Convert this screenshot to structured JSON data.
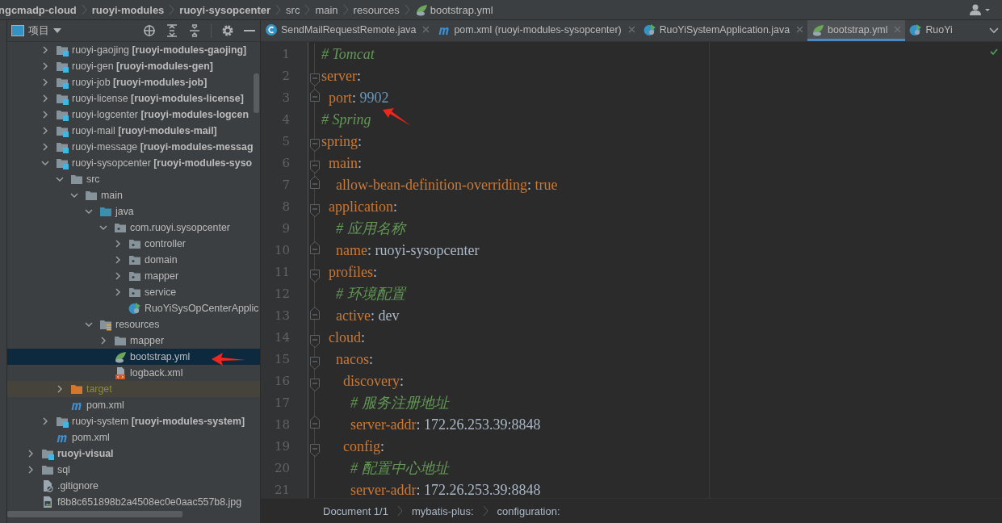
{
  "breadcrumbs": [
    {
      "label": "ngcmadp-cloud",
      "kind": "module"
    },
    {
      "label": "ruoyi-modules",
      "kind": "module"
    },
    {
      "label": "ruoyi-sysopcenter",
      "kind": "module"
    },
    {
      "label": "src",
      "kind": "folder"
    },
    {
      "label": "main",
      "kind": "folder"
    },
    {
      "label": "resources",
      "kind": "folder"
    },
    {
      "label": "bootstrap.yml",
      "kind": "yml"
    }
  ],
  "project": {
    "title": "项目",
    "tree": [
      {
        "children": [
          {
            "label": "ruoyi-gaojing **[ruoyi-modules-gaojing]**",
            "kind": "module",
            "expanded": false,
            "selected": false
          },
          {
            "label": "ruoyi-gen **[ruoyi-modules-gen]**",
            "kind": "module",
            "expanded": false,
            "selected": false
          },
          {
            "label": "ruoyi-job **[ruoyi-modules-job]**",
            "kind": "module",
            "expanded": false,
            "selected": false
          },
          {
            "label": "ruoyi-license **[ruoyi-modules-license]**",
            "kind": "module",
            "expanded": false,
            "selected": false
          },
          {
            "label": "ruoyi-logcenter **[ruoyi-modules-logcen**",
            "kind": "module",
            "expanded": false,
            "selected": false
          },
          {
            "label": "ruoyi-mail **[ruoyi-modules-mail]**",
            "kind": "module",
            "expanded": false,
            "selected": false
          },
          {
            "label": "ruoyi-message **[ruoyi-modules-messag**",
            "kind": "module",
            "expanded": false,
            "selected": false
          },
          {
            "label": "ruoyi-sysopcenter **[ruoyi-modules-syso**",
            "kind": "module",
            "expanded": true,
            "selected": false,
            "children": [
              {
                "label": "src",
                "kind": "folder",
                "expanded": true,
                "selected": false,
                "children": [
                  {
                    "label": "main",
                    "kind": "folder",
                    "expanded": true,
                    "selected": false,
                    "children": [
                      {
                        "label": "java",
                        "kind": "source",
                        "expanded": true,
                        "selected": false,
                        "children": [
                          {
                            "label": "com.ruoyi.sysopcenter",
                            "kind": "package",
                            "expanded": true,
                            "selected": false,
                            "children": [
                              {
                                "label": "controller",
                                "kind": "package",
                                "expanded": false,
                                "selected": false
                              },
                              {
                                "label": "domain",
                                "kind": "package",
                                "expanded": false,
                                "selected": false
                              },
                              {
                                "label": "mapper",
                                "kind": "package",
                                "expanded": false,
                                "selected": false
                              },
                              {
                                "label": "service",
                                "kind": "package",
                                "expanded": false,
                                "selected": false
                              },
                              {
                                "label": "RuoYiSysOpCenterApplic",
                                "kind": "boot-class",
                                "selected": false
                              }
                            ]
                          }
                        ]
                      },
                      {
                        "label": "resources",
                        "kind": "resources",
                        "expanded": true,
                        "selected": false,
                        "children": [
                          {
                            "label": "mapper",
                            "kind": "folder",
                            "expanded": false,
                            "selected": false
                          },
                          {
                            "label": "bootstrap.yml",
                            "kind": "yml",
                            "selected": true
                          },
                          {
                            "label": "logback.xml",
                            "kind": "xml",
                            "selected": false
                          }
                        ]
                      }
                    ]
                  }
                ]
              },
              {
                "label": "target",
                "kind": "excluded",
                "expanded": false,
                "selected": false
              },
              {
                "label": "pom.xml",
                "kind": "maven",
                "selected": false
              }
            ]
          },
          {
            "label": "ruoyi-system **[ruoyi-modules-system]**",
            "kind": "module",
            "expanded": false,
            "selected": false
          },
          {
            "label": "pom.xml",
            "kind": "maven",
            "selected": false
          }
        ]
      },
      {
        "label": "**ruoyi-visual**",
        "kind": "module",
        "expanded": false,
        "selected": false
      },
      {
        "label": "sql",
        "kind": "folder",
        "expanded": false,
        "selected": false
      },
      {
        "label": ".gitignore",
        "kind": "ignore",
        "selected": false
      },
      {
        "label": "f8b8c651898b2a4508ec0e0aac557b8.jpg",
        "kind": "image",
        "selected": false
      }
    ]
  },
  "tabs": [
    {
      "label": "SendMailRequestRemote.java",
      "kind": "class",
      "selected": false,
      "closable": true
    },
    {
      "label": "pom.xml (ruoyi-modules-sysopcenter)",
      "kind": "maven",
      "selected": false,
      "closable": true
    },
    {
      "label": "RuoYiSystemApplication.java",
      "kind": "boot-class",
      "selected": false,
      "closable": true
    },
    {
      "label": "bootstrap.yml",
      "kind": "yml",
      "selected": true,
      "closable": true
    },
    {
      "label": "RuoYi",
      "kind": "boot-class",
      "selected": false,
      "closable": false
    }
  ],
  "code": [
    {
      "number": "1",
      "fold_start": false,
      "fold_end": false,
      "parts": [
        {
          "kind": "comment",
          "text": "# Tomcat"
        }
      ]
    },
    {
      "number": "2",
      "fold_start": true,
      "fold_end": false,
      "parts": [
        {
          "kind": "key",
          "text": "server"
        },
        {
          "kind": "sign",
          "text": ":"
        }
      ]
    },
    {
      "number": "3",
      "fold_start": false,
      "fold_end": true,
      "parts": [
        {
          "kind": "key",
          "text": "  port"
        },
        {
          "kind": "sign",
          "text": ": "
        },
        {
          "kind": "number",
          "text": "9902"
        }
      ]
    },
    {
      "number": "4",
      "fold_start": false,
      "fold_end": false,
      "parts": [
        {
          "kind": "comment",
          "text": "# Spring"
        }
      ]
    },
    {
      "number": "5",
      "fold_start": true,
      "fold_end": false,
      "parts": [
        {
          "kind": "key",
          "text": "spring"
        },
        {
          "kind": "sign",
          "text": ":"
        }
      ]
    },
    {
      "number": "6",
      "fold_start": true,
      "fold_end": false,
      "parts": [
        {
          "kind": "key",
          "text": "  main"
        },
        {
          "kind": "sign",
          "text": ":"
        }
      ]
    },
    {
      "number": "7",
      "fold_start": false,
      "fold_end": true,
      "parts": [
        {
          "kind": "key",
          "text": "    allow-bean-definition-overriding"
        },
        {
          "kind": "sign",
          "text": ": "
        },
        {
          "kind": "keyword",
          "text": "true"
        }
      ]
    },
    {
      "number": "8",
      "fold_start": true,
      "fold_end": false,
      "parts": [
        {
          "kind": "key",
          "text": "  application"
        },
        {
          "kind": "sign",
          "text": ":"
        }
      ]
    },
    {
      "number": "9",
      "fold_start": false,
      "fold_end": false,
      "parts": [
        {
          "kind": "comment",
          "text": "    # 应用名称"
        }
      ]
    },
    {
      "number": "10",
      "fold_start": false,
      "fold_end": true,
      "parts": [
        {
          "kind": "key",
          "text": "    name"
        },
        {
          "kind": "sign",
          "text": ": "
        },
        {
          "kind": "value",
          "text": "ruoyi-sysopcenter"
        }
      ]
    },
    {
      "number": "11",
      "fold_start": true,
      "fold_end": false,
      "parts": [
        {
          "kind": "key",
          "text": "  profiles"
        },
        {
          "kind": "sign",
          "text": ":"
        }
      ]
    },
    {
      "number": "12",
      "fold_start": false,
      "fold_end": false,
      "parts": [
        {
          "kind": "comment",
          "text": "    # 环境配置"
        }
      ]
    },
    {
      "number": "13",
      "fold_start": false,
      "fold_end": true,
      "parts": [
        {
          "kind": "key",
          "text": "    active"
        },
        {
          "kind": "sign",
          "text": ": "
        },
        {
          "kind": "value",
          "text": "dev"
        }
      ]
    },
    {
      "number": "14",
      "fold_start": true,
      "fold_end": false,
      "parts": [
        {
          "kind": "key",
          "text": "  cloud"
        },
        {
          "kind": "sign",
          "text": ":"
        }
      ]
    },
    {
      "number": "15",
      "fold_start": true,
      "fold_end": false,
      "parts": [
        {
          "kind": "key",
          "text": "    nacos"
        },
        {
          "kind": "sign",
          "text": ":"
        }
      ]
    },
    {
      "number": "16",
      "fold_start": true,
      "fold_end": false,
      "parts": [
        {
          "kind": "key",
          "text": "      discovery"
        },
        {
          "kind": "sign",
          "text": ":"
        }
      ]
    },
    {
      "number": "17",
      "fold_start": false,
      "fold_end": false,
      "parts": [
        {
          "kind": "comment",
          "text": "        # 服务注册地址"
        }
      ]
    },
    {
      "number": "18",
      "fold_start": false,
      "fold_end": true,
      "parts": [
        {
          "kind": "key",
          "text": "        server-addr"
        },
        {
          "kind": "sign",
          "text": ": "
        },
        {
          "kind": "value",
          "text": "172.26.253.39:8848"
        }
      ]
    },
    {
      "number": "19",
      "fold_start": true,
      "fold_end": false,
      "parts": [
        {
          "kind": "key",
          "text": "      config"
        },
        {
          "kind": "sign",
          "text": ":"
        }
      ]
    },
    {
      "number": "20",
      "fold_start": false,
      "fold_end": false,
      "parts": [
        {
          "kind": "comment",
          "text": "        # 配置中心地址"
        }
      ]
    },
    {
      "number": "21",
      "fold_start": false,
      "fold_end": false,
      "parts": [
        {
          "kind": "key",
          "text": "        server-addr"
        },
        {
          "kind": "sign",
          "text": ": "
        },
        {
          "kind": "value",
          "text": "172.26.253.39:8848"
        }
      ]
    }
  ],
  "editor_breadcrumbs": [
    "Document 1/1",
    "mybatis-plus:",
    "configuration:"
  ]
}
